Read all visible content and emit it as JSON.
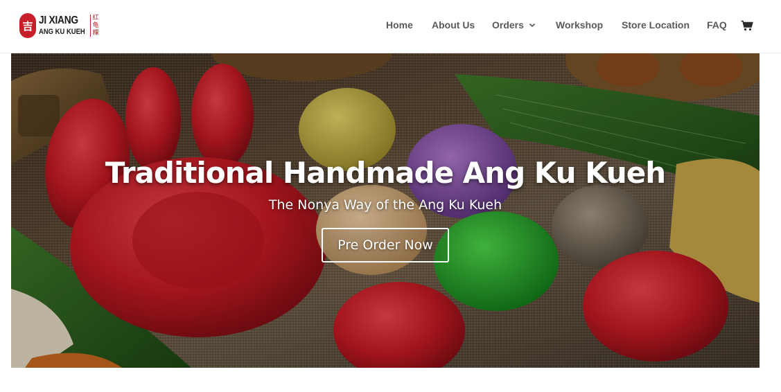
{
  "brand": {
    "seal_char": "吉",
    "line1": "JI XIANG",
    "line2": "ANG KU KUEH",
    "chinese": [
      "红",
      "龟",
      "粿"
    ],
    "primary_color": "#c8202a"
  },
  "nav": {
    "items": [
      {
        "label": "Home"
      },
      {
        "label": "About Us"
      },
      {
        "label": "Orders",
        "has_dropdown": true
      },
      {
        "label": "Workshop"
      },
      {
        "label": "Store Location"
      },
      {
        "label": "FAQ"
      }
    ],
    "cart_icon": "cart-icon",
    "text_color": "#5a5a5a"
  },
  "hero": {
    "title": "Traditional Handmade Ang Ku Kueh",
    "subtitle": "The Nonya Way of the Ang Ku Kueh",
    "cta_label": "Pre Order Now"
  }
}
